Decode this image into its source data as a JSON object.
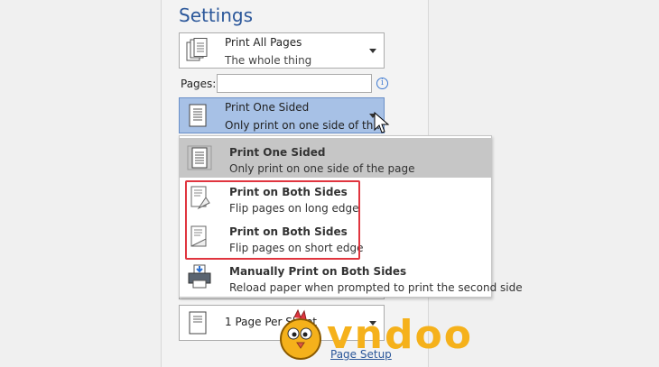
{
  "settings": {
    "title": "Settings",
    "pages_dropdown": {
      "main": "Print All Pages",
      "sub": "The whole thing"
    },
    "pages_label": "Pages:",
    "pages_value": "",
    "sides_dropdown": {
      "main": "Print One Sided",
      "sub": "Only print on one side of th..."
    },
    "per_sheet_dropdown": {
      "main": "1 Page Per Sheet"
    },
    "page_setup_link": "Page Setup"
  },
  "menu": {
    "items": [
      {
        "main": "Print One Sided",
        "sub": "Only print on one side of the page",
        "selected": true,
        "icon": "one-sided-icon"
      },
      {
        "main": "Print on Both Sides",
        "sub": "Flip pages on long edge",
        "selected": false,
        "icon": "flip-long-edge-icon"
      },
      {
        "main": "Print on Both Sides",
        "sub": "Flip pages on short edge",
        "selected": false,
        "icon": "flip-short-edge-icon"
      },
      {
        "main": "Manually Print on Both Sides",
        "sub": "Reload paper when prompted to print the second side",
        "selected": false,
        "icon": "manual-duplex-icon"
      }
    ]
  },
  "watermark": {
    "text": "vndoo"
  },
  "colors": {
    "accent": "#2b579a",
    "selected_dropdown": "#a7c1e6",
    "highlight_box": "#e0353f",
    "watermark": "#f5b11b"
  }
}
